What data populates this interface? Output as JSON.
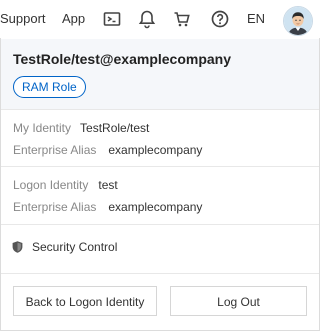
{
  "topbar": {
    "support_label": "Support",
    "app_label": "App",
    "language_label": "EN",
    "icons": [
      "terminal-icon",
      "bell-icon",
      "cart-icon",
      "help-icon"
    ]
  },
  "identity": {
    "account_name": "TestRole/test@examplecompany",
    "role_badge": "RAM Role"
  },
  "my_identity": {
    "identity_label": "My Identity",
    "identity_value": "TestRole/test",
    "alias_label": "Enterprise Alias",
    "alias_value": "examplecompany"
  },
  "logon_identity": {
    "identity_label": "Logon Identity",
    "identity_value": "test",
    "alias_label": "Enterprise Alias",
    "alias_value": "examplecompany"
  },
  "security": {
    "label": "Security Control"
  },
  "actions": {
    "back_label": "Back to Logon Identity",
    "logout_label": "Log Out"
  },
  "colors": {
    "accent": "#0064c8",
    "header_bg": "#f5f7fa"
  }
}
